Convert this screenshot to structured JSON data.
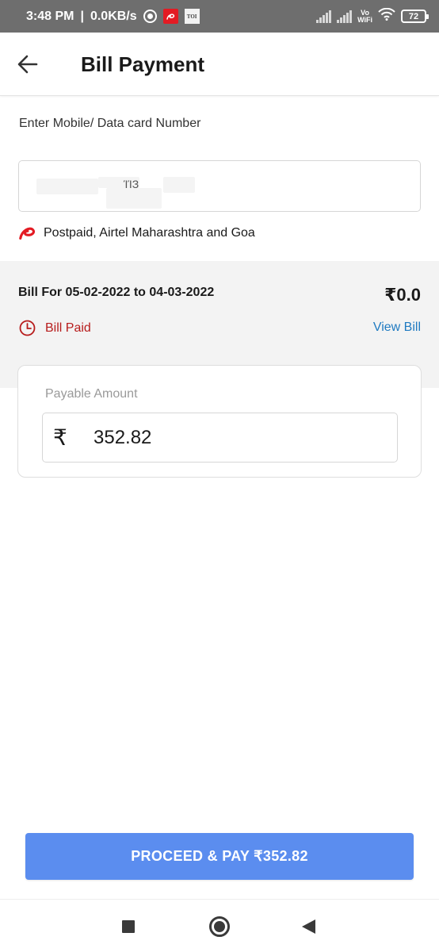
{
  "status_bar": {
    "time": "3:48 PM",
    "network_speed": "0.0KB/s",
    "separator": "|",
    "notification_icons": [
      "record-icon",
      "airtel-app-icon",
      "toi-app-icon"
    ],
    "toi_label": "TOI",
    "vowifi_top": "Vo",
    "vowifi_bottom": "WiFi",
    "battery_level": "72"
  },
  "header": {
    "title": "Bill Payment",
    "back_icon": "arrow-left-icon"
  },
  "mobile_field": {
    "label": "Enter Mobile/ Data card Number",
    "value_fragment": "ΊΊЗ"
  },
  "operator": {
    "text": "Postpaid, Airtel Maharashtra and Goa",
    "brand_color": "#e31b23"
  },
  "bill": {
    "period": "Bill For 05-02-2022 to 04-03-2022",
    "amount": "₹0.0",
    "status": "Bill Paid",
    "status_color": "#b71c1c",
    "view_bill_label": "View Bill",
    "link_color": "#1f7ac1"
  },
  "payable": {
    "label": "Payable Amount",
    "currency_symbol": "₹",
    "amount": "352.82"
  },
  "proceed_button": {
    "label": "PROCEED & PAY ₹352.82",
    "color": "#5b8def"
  },
  "nav_bar": {
    "icons": [
      "recents-icon",
      "home-icon",
      "back-icon"
    ]
  }
}
